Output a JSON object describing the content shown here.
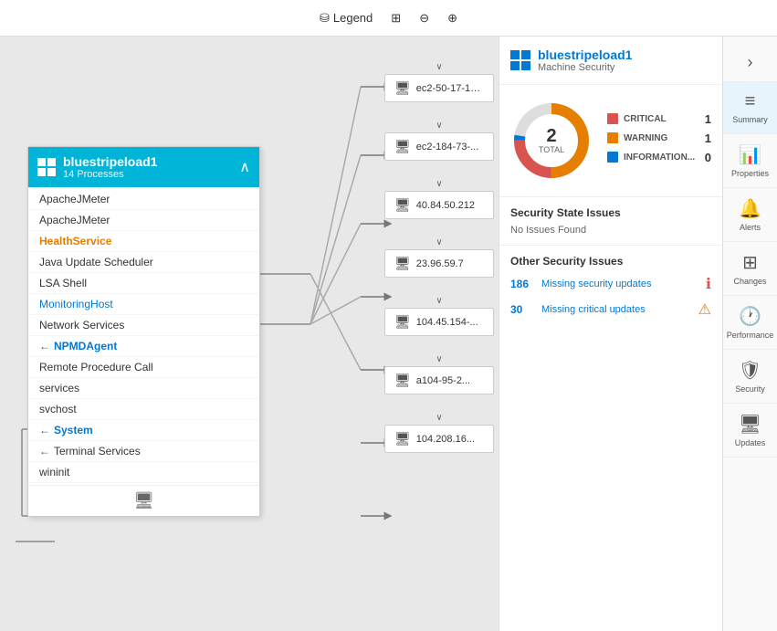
{
  "toolbar": {
    "legend_label": "Legend",
    "grid_icon": "⊞",
    "zoom_out_icon": "🔍",
    "zoom_in_icon": "🔍"
  },
  "node_card": {
    "title": "bluestripeload1",
    "subtitle": "14 Processes",
    "collapse_icon": "∧",
    "processes": [
      {
        "label": "ApacheJMeter",
        "style": "normal",
        "has_arrow": false
      },
      {
        "label": "ApacheJMeter",
        "style": "normal",
        "has_arrow": false
      },
      {
        "label": "HealthService",
        "style": "orange",
        "has_arrow": false
      },
      {
        "label": "Java Update Scheduler",
        "style": "normal",
        "has_arrow": false
      },
      {
        "label": "LSA Shell",
        "style": "normal",
        "has_arrow": false
      },
      {
        "label": "MonitoringHost",
        "style": "blue-link",
        "has_arrow": false
      },
      {
        "label": "Network Services",
        "style": "normal",
        "has_arrow": false
      },
      {
        "label": "NPMDAgent",
        "style": "highlighted",
        "has_arrow": true
      },
      {
        "label": "Remote Procedure Call",
        "style": "normal",
        "has_arrow": false
      },
      {
        "label": "services",
        "style": "normal",
        "has_arrow": false
      },
      {
        "label": "svchost",
        "style": "normal",
        "has_arrow": false
      },
      {
        "label": "System",
        "style": "highlighted",
        "has_arrow": true
      },
      {
        "label": "Terminal Services",
        "style": "normal",
        "has_arrow": true
      },
      {
        "label": "wininit",
        "style": "normal",
        "has_arrow": false
      }
    ],
    "footer_icon": "🖥"
  },
  "remote_groups": [
    {
      "nodes": [
        {
          "label": "ec2-50-17-19...",
          "expand": true
        }
      ]
    },
    {
      "nodes": [
        {
          "label": "ec2-184-73-...",
          "expand": true
        }
      ]
    },
    {
      "nodes": [
        {
          "label": "40.84.50.212",
          "expand": true
        }
      ]
    },
    {
      "nodes": [
        {
          "label": "23.96.59.7",
          "expand": true
        }
      ]
    },
    {
      "nodes": [
        {
          "label": "104.45.154-...",
          "expand": true
        }
      ]
    },
    {
      "nodes": [
        {
          "label": "a104-95-2...",
          "expand": true
        }
      ]
    },
    {
      "nodes": [
        {
          "label": "104.208.16...",
          "expand": true
        }
      ]
    }
  ],
  "right_panel": {
    "title": "bluestripeload1",
    "subtitle": "Machine Security",
    "donut": {
      "total": "2",
      "total_label": "TOTAL",
      "legend": [
        {
          "label": "CRITICAL",
          "count": "1",
          "color": "#d9534f"
        },
        {
          "label": "WARNING",
          "count": "1",
          "color": "#e67e00"
        },
        {
          "label": "INFORMATION...",
          "count": "0",
          "color": "#0078d4"
        }
      ]
    },
    "security_state": {
      "title": "Security State Issues",
      "message": "No Issues Found"
    },
    "other_issues": {
      "title": "Other Security Issues",
      "items": [
        {
          "count": "186",
          "label": "Missing security updates",
          "icon_type": "red"
        },
        {
          "count": "30",
          "label": "Missing critical updates",
          "icon_type": "yellow"
        }
      ]
    }
  },
  "side_nav": {
    "items": [
      {
        "label": "Summary",
        "icon": "≡"
      },
      {
        "label": "Properties",
        "icon": "📊"
      },
      {
        "label": "Alerts",
        "icon": "🔔"
      },
      {
        "label": "Changes",
        "icon": "⊞"
      },
      {
        "label": "Performance",
        "icon": "🕐"
      },
      {
        "label": "Security",
        "icon": "🛡"
      },
      {
        "label": "Updates",
        "icon": "🖥"
      }
    ]
  }
}
